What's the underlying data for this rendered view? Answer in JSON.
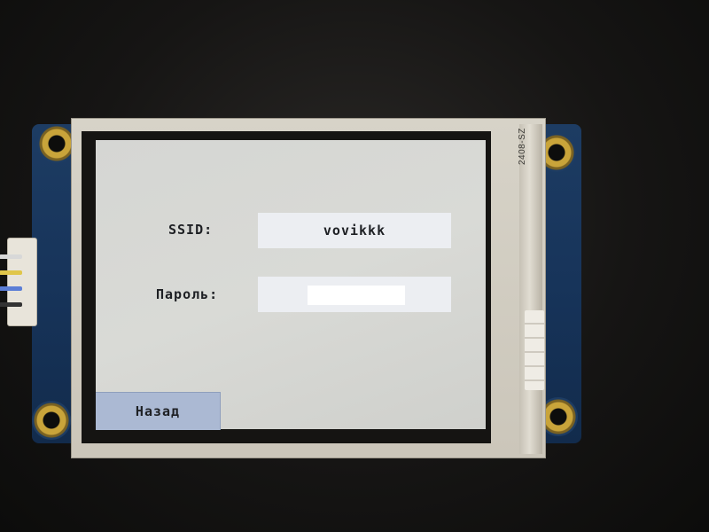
{
  "device": {
    "pcb_color": "#1d3c63",
    "flex_label": "2408-SZ"
  },
  "screen": {
    "background_color": "#d6d7d3",
    "ssid_label": "SSID:",
    "ssid_value": "vovikkk",
    "password_label": "Пароль:",
    "password_value": "",
    "back_button_label": "Назад",
    "back_button_color": "#abb9d3"
  }
}
